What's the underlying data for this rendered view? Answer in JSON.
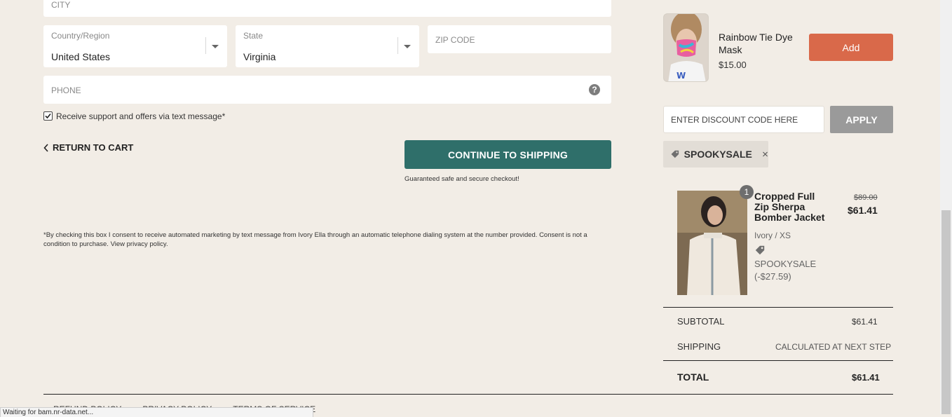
{
  "address": {
    "city_placeholder": "CITY",
    "country_label": "Country/Region",
    "country_value": "United States",
    "state_label": "State",
    "state_value": "Virginia",
    "zip_placeholder": "ZIP CODE",
    "phone_placeholder": "PHONE",
    "help_icon": "question-circle-icon"
  },
  "sms_opt_in": {
    "checked": true,
    "label": "Receive support and offers via text message*"
  },
  "nav": {
    "return_label": "RETURN TO CART",
    "continue_label": "CONTINUE TO SHIPPING",
    "secure_note": "Guaranteed safe and secure checkout!"
  },
  "disclaimer": "*By checking this box I consent to receive automated marketing by text message from Ivory Ella through an automatic telephone dialing system at the number provided. Consent is not a condition to purchase. View privacy policy.",
  "upsell": {
    "name": "Rainbow Tie Dye Mask",
    "price": "$15.00",
    "add_label": "Add"
  },
  "discount": {
    "placeholder": "ENTER DISCOUNT CODE HERE",
    "apply_label": "APPLY",
    "applied_code": "SPOOKYSALE"
  },
  "cart_item": {
    "quantity": "1",
    "name": "Cropped Full Zip Sherpa Bomber Jacket",
    "variant": "Ivory / XS",
    "discount_code": "SPOOKYSALE",
    "discount_amount": "(-$27.59)",
    "original_price": "$89.00",
    "price": "$61.41"
  },
  "totals": {
    "subtotal_label": "SUBTOTAL",
    "subtotal_value": "$61.41",
    "shipping_label": "SHIPPING",
    "shipping_value": "CALCULATED AT NEXT STEP",
    "total_label": "TOTAL",
    "total_value": "$61.41"
  },
  "footer": {
    "links": [
      "REFUND POLICY",
      "PRIVACY POLICY",
      "TERMS OF SERVICE"
    ]
  },
  "status_bar": {
    "text": "Waiting for bam.nr-data.net..."
  },
  "colors": {
    "accent_teal": "#2f6f6a",
    "add_orange": "#d9694a",
    "page_bg": "#f2ede6"
  }
}
